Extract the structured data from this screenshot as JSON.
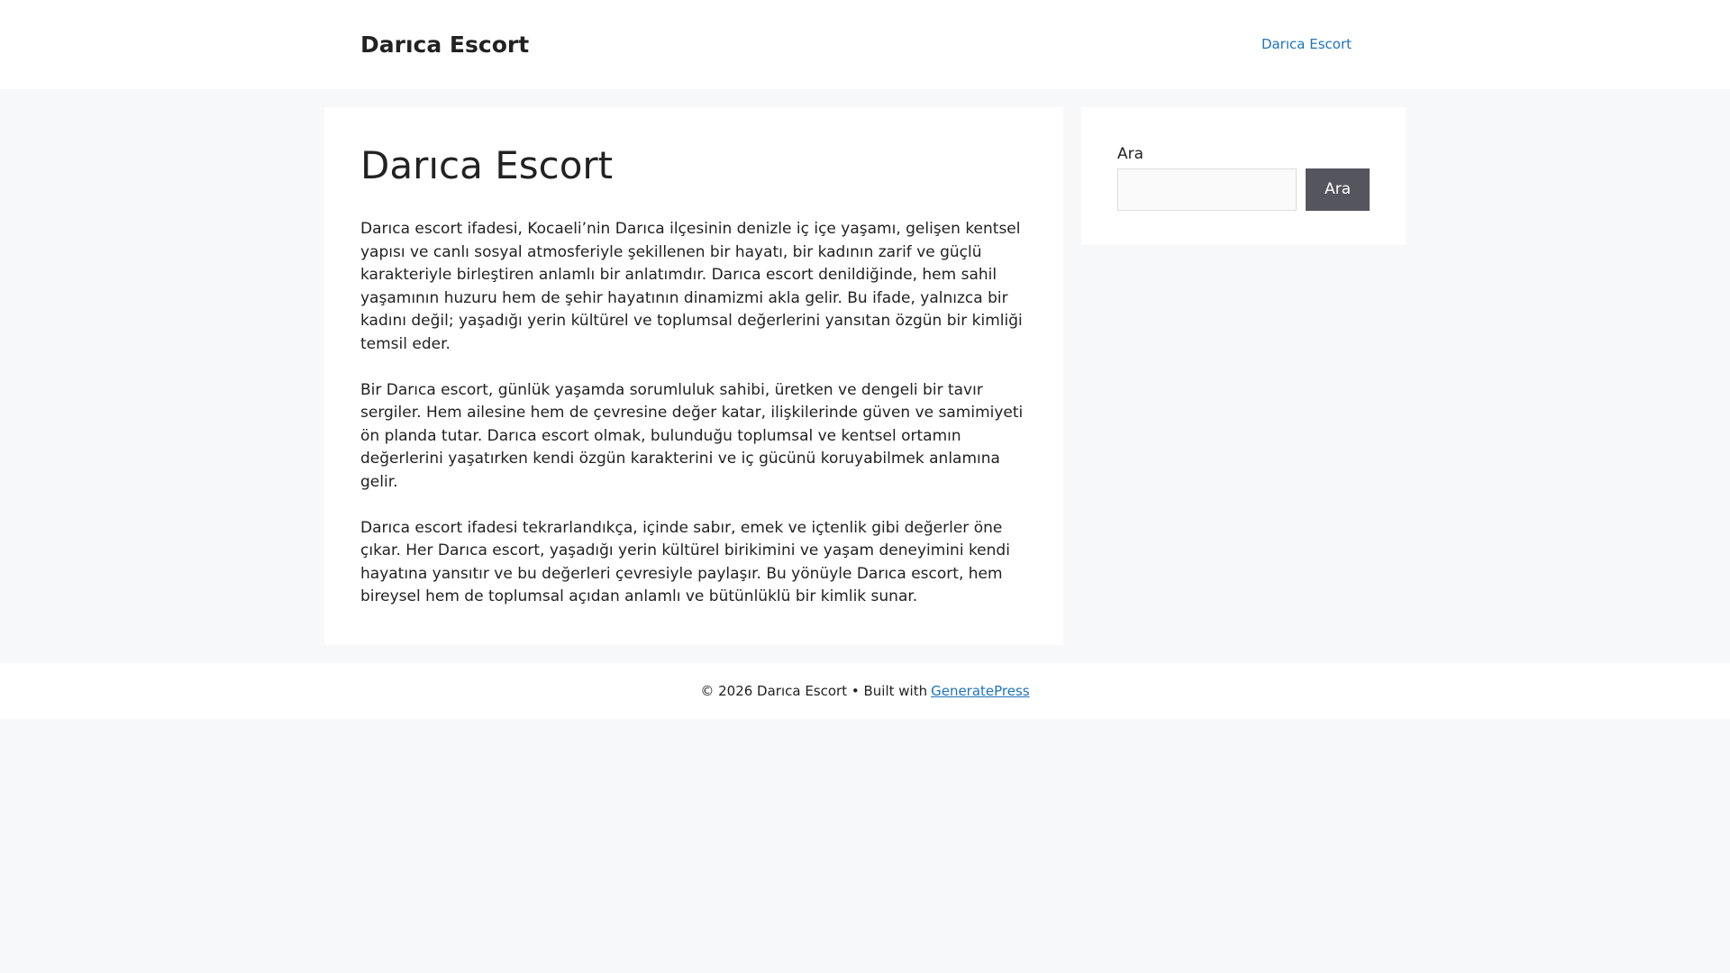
{
  "header": {
    "site_title": "Darıca Escort",
    "nav": [
      "Darıca Escort"
    ]
  },
  "main": {
    "title": "Darıca Escort",
    "paragraphs": [
      "Darıca escort ifadesi, Kocaeli’nin Darıca ilçesinin denizle iç içe yaşamı, gelişen kentsel yapısı ve canlı sosyal atmosferiyle şekillenen bir hayatı, bir kadının zarif ve güçlü karakteriyle birleştiren anlamlı bir anlatımdır. Darıca escort denildiğinde, hem sahil yaşamının huzuru hem de şehir hayatının dinamizmi akla gelir. Bu ifade, yalnızca bir kadını değil; yaşadığı yerin kültürel ve toplumsal değerlerini yansıtan özgün bir kimliği temsil eder.",
      "Bir Darıca escort, günlük yaşamda sorumluluk sahibi, üretken ve dengeli bir tavır sergiler. Hem ailesine hem de çevresine değer katar, ilişkilerinde güven ve samimiyeti ön planda tutar. Darıca escort olmak, bulunduğu toplumsal ve kentsel ortamın değerlerini yaşatırken kendi özgün karakterini ve iç gücünü koruyabilmek anlamına gelir.",
      "Darıca escort ifadesi tekrarlandıkça, içinde sabır, emek ve içtenlik gibi değerler öne çıkar. Her Darıca escort, yaşadığı yerin kültürel birikimini ve yaşam deneyimini kendi hayatına yansıtır ve bu değerleri çevresiyle paylaşır. Bu yönüyle Darıca escort, hem bireysel hem de toplumsal açıdan anlamlı ve bütünlüklü bir kimlik sunar."
    ]
  },
  "sidebar": {
    "search_label": "Ara",
    "search_value": "",
    "search_button": "Ara"
  },
  "footer": {
    "text": "© 2026 Darıca Escort • Built with",
    "link": "GeneratePress"
  }
}
